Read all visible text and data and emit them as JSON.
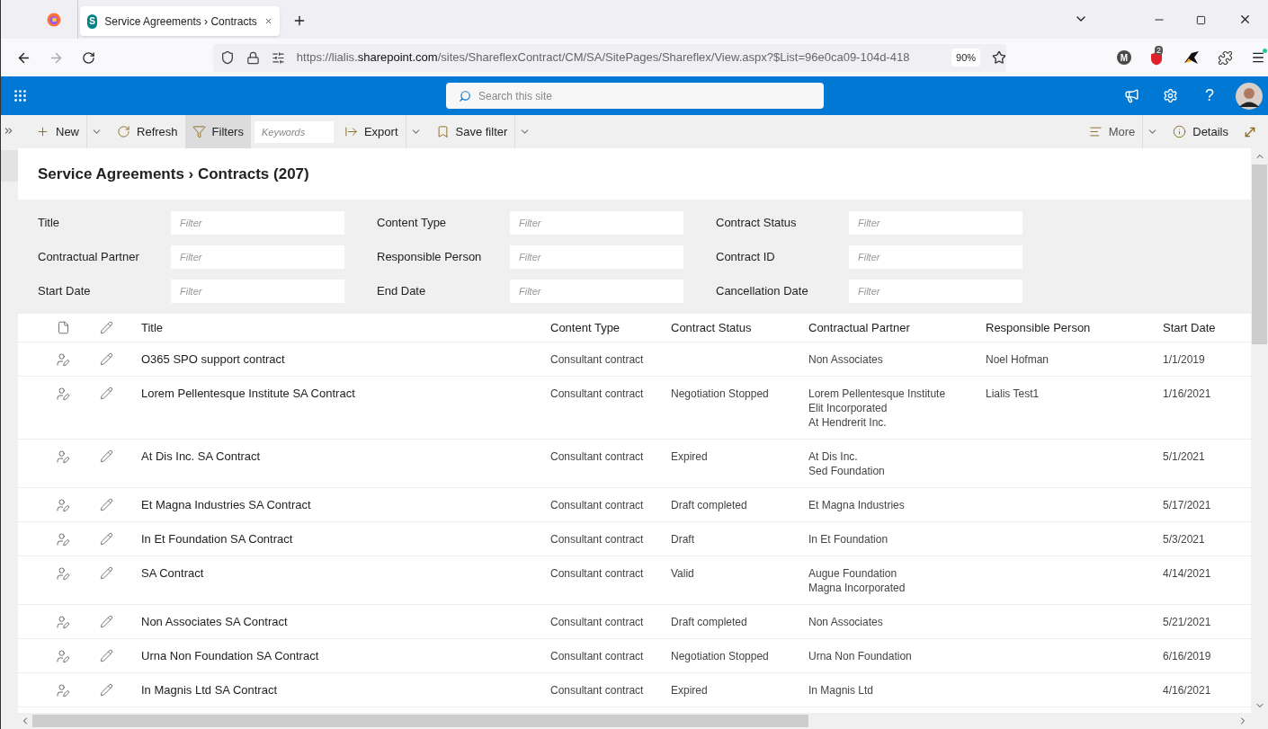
{
  "browser": {
    "tab": {
      "favicon_letter": "S",
      "title": "Service Agreements › Contracts"
    },
    "url": {
      "host_start": "https://lialis.",
      "domain": "sharepoint.com",
      "path": "/sites/ShareflexContract/CM/SA/SitePages/Shareflex/View.aspx?$List=96e0ca09-104d-418"
    },
    "zoom": "90%",
    "extensions": [
      {
        "kind": "letter",
        "text": "M"
      },
      {
        "kind": "badge",
        "text": "2"
      },
      {
        "kind": "bird"
      },
      {
        "kind": "puzzle"
      }
    ]
  },
  "suite_bar": {
    "search": {
      "placeholder": "Search this site"
    },
    "help": "?"
  },
  "command_bar": {
    "left": [
      {
        "kind": "new",
        "label": "New",
        "dropdown": true,
        "selected": false
      },
      {
        "kind": "refresh",
        "label": "Refresh",
        "dropdown": false,
        "selected": false
      },
      {
        "kind": "filters",
        "label": "Filters",
        "dropdown": false,
        "selected": true
      },
      {
        "kind": "keywords",
        "placeholder": "Keywords"
      },
      {
        "kind": "export",
        "label": "Export",
        "dropdown": true,
        "selected": false
      },
      {
        "kind": "save",
        "label": "Save filter",
        "dropdown": true,
        "selected": false
      }
    ],
    "right": [
      {
        "kind": "more",
        "label": "More",
        "dropdown": true,
        "selected": false
      },
      {
        "kind": "details",
        "label": "Details",
        "dropdown": false,
        "selected": false
      },
      {
        "kind": "expand"
      }
    ]
  },
  "heading": "Service Agreements › Contracts (207)",
  "filters": [
    {
      "label": "Title",
      "placeholder": "Filter"
    },
    {
      "label": "Content Type",
      "placeholder": "Filter"
    },
    {
      "label": "Contract Status",
      "placeholder": "Filter"
    },
    {
      "label": "Contractual Partner",
      "placeholder": "Filter"
    },
    {
      "label": "Responsible Person",
      "placeholder": "Filter"
    },
    {
      "label": "Contract ID",
      "placeholder": "Filter"
    },
    {
      "label": "Start Date",
      "placeholder": "Filter"
    },
    {
      "label": "End Date",
      "placeholder": "Filter"
    },
    {
      "label": "Cancellation Date",
      "placeholder": "Filter"
    }
  ],
  "table": {
    "columns": [
      "Title",
      "Content Type",
      "Contract Status",
      "Contractual Partner",
      "Responsible Person",
      "Start Date"
    ],
    "rows": [
      {
        "title": "O365 SPO support contract",
        "content_type": "Consultant contract",
        "status": "",
        "partners": [
          "Non Associates"
        ],
        "person": "Noel Hofman",
        "start_date": "1/1/2019"
      },
      {
        "title": "Lorem Pellentesque Institute SA Contract",
        "content_type": "Consultant contract",
        "status": "Negotiation Stopped",
        "partners": [
          "Lorem Pellentesque Institute",
          "Elit Incorporated",
          "At Hendrerit Inc."
        ],
        "person": "Lialis Test1",
        "start_date": "1/16/2021"
      },
      {
        "title": "At Dis Inc. SA Contract",
        "content_type": "Consultant contract",
        "status": "Expired",
        "partners": [
          "At Dis Inc.",
          "Sed Foundation"
        ],
        "person": "",
        "start_date": "5/1/2021"
      },
      {
        "title": "Et Magna Industries SA Contract",
        "content_type": "Consultant contract",
        "status": "Draft completed",
        "partners": [
          "Et Magna Industries"
        ],
        "person": "",
        "start_date": "5/17/2021"
      },
      {
        "title": "In Et Foundation SA Contract",
        "content_type": "Consultant contract",
        "status": "Draft",
        "partners": [
          "In Et Foundation"
        ],
        "person": "",
        "start_date": "5/3/2021"
      },
      {
        "title": "SA Contract",
        "content_type": "Consultant contract",
        "status": "Valid",
        "partners": [
          "Augue Foundation",
          "Magna Incorporated"
        ],
        "person": "",
        "start_date": "4/14/2021"
      },
      {
        "title": "Non Associates SA Contract",
        "content_type": "Consultant contract",
        "status": "Draft completed",
        "partners": [
          "Non Associates"
        ],
        "person": "",
        "start_date": "5/21/2021"
      },
      {
        "title": "Urna Non Foundation SA Contract",
        "content_type": "Consultant contract",
        "status": "Negotiation Stopped",
        "partners": [
          "Urna Non Foundation"
        ],
        "person": "",
        "start_date": "6/16/2019"
      },
      {
        "title": "In Magnis Ltd SA Contract",
        "content_type": "Consultant contract",
        "status": "Expired",
        "partners": [
          "In Magnis Ltd"
        ],
        "person": "",
        "start_date": "4/16/2021"
      }
    ]
  }
}
